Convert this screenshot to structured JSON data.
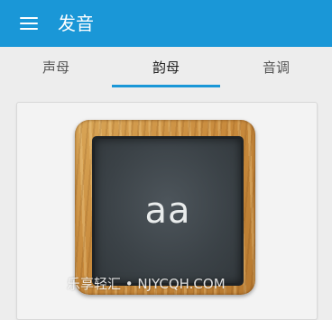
{
  "app_bar": {
    "title": "发音",
    "menu_icon": "hamburger-menu-icon",
    "color": "#1a97d7"
  },
  "tabs": [
    {
      "label": "声母",
      "selected": false
    },
    {
      "label": "韵母",
      "selected": true
    },
    {
      "label": "音调",
      "selected": false
    }
  ],
  "card": {
    "board_text": "aa"
  },
  "watermark": "乐享轻汇 • NJYCQH.COM"
}
